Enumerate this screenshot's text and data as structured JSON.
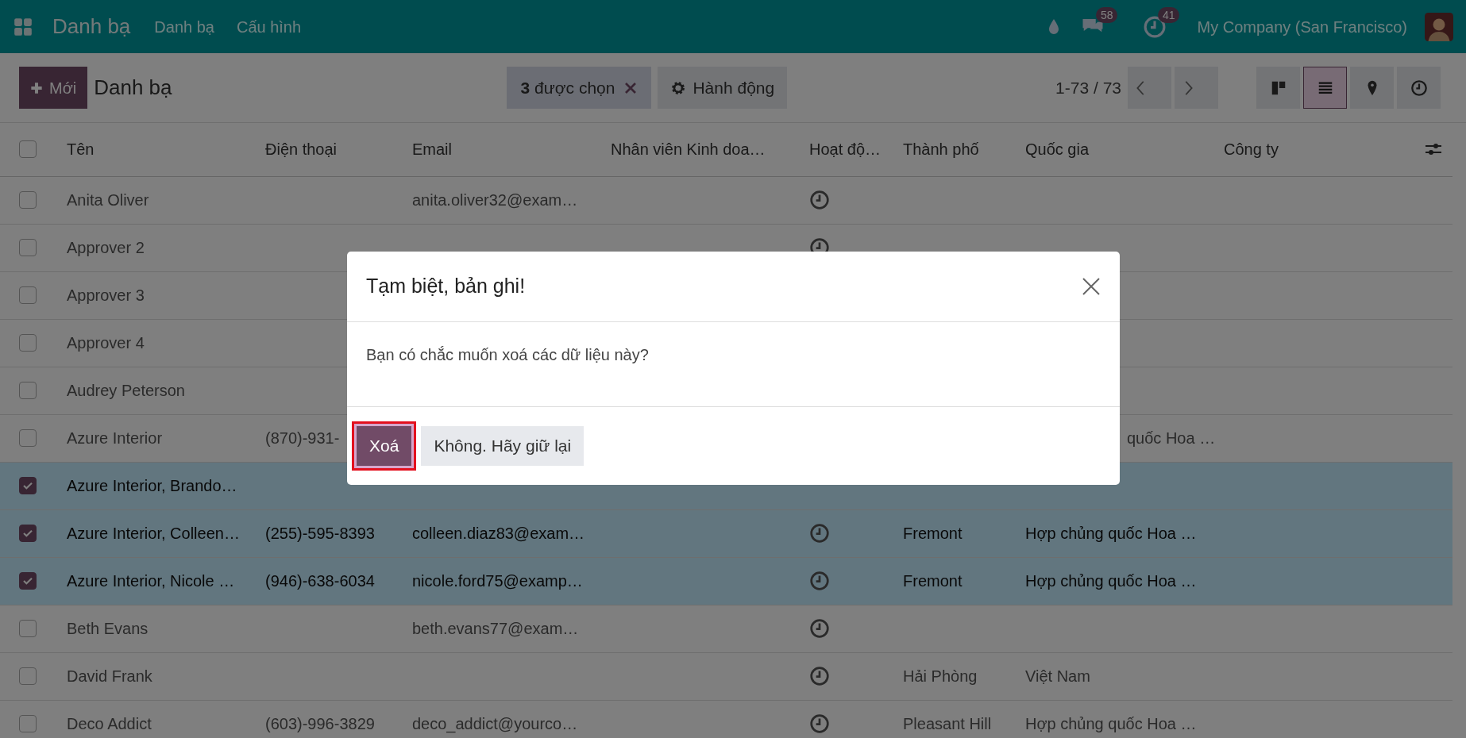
{
  "navbar": {
    "app_title": "Danh bạ",
    "menus": [
      "Danh bạ",
      "Cấu hình"
    ],
    "messages_badge": "58",
    "activities_badge": "41",
    "company": "My Company (San Francisco)"
  },
  "control_panel": {
    "new_button": "Mới",
    "breadcrumb": "Danh bạ",
    "selection": "**3** được chọn",
    "action_button": "Hành động",
    "pager": "1-73 / 73",
    "views": [
      {
        "kind": "kanban",
        "selected": false
      },
      {
        "kind": "list",
        "selected": true
      },
      {
        "kind": "map",
        "selected": false
      },
      {
        "kind": "activity",
        "selected": false
      }
    ]
  },
  "table": {
    "all_selected": false,
    "columns": [
      "Tên",
      "Điện thoại",
      "Email",
      "Nhân viên Kinh doa…",
      "Hoạt độ…",
      "Thành phố",
      "Quốc gia",
      "Công ty"
    ],
    "rows": [
      {
        "name": "Anita Oliver",
        "email": "anita.oliver32@exam…",
        "activity": true,
        "selected": false
      },
      {
        "name": "Approver 2",
        "activity": true,
        "selected": false
      },
      {
        "name": "Approver 3",
        "activity": false,
        "selected": false
      },
      {
        "name": "Approver 4",
        "activity": false,
        "selected": false
      },
      {
        "name": "Audrey Peterson",
        "activity": false,
        "selected": false
      },
      {
        "name": "Azure Interior",
        "phone": "(870)-931-",
        "activity": false,
        "country": "quốc Hoa …",
        "country_clipped": true,
        "selected": false
      },
      {
        "name": "Azure Interior, Brando…",
        "activity": false,
        "selected": true
      },
      {
        "name": "Azure Interior, Colleen…",
        "phone": "(255)-595-8393",
        "email": "colleen.diaz83@exam…",
        "activity": true,
        "city": "Fremont",
        "country": "Hợp chủng quốc Hoa …",
        "selected": true
      },
      {
        "name": "Azure Interior, Nicole …",
        "phone": "(946)-638-6034",
        "email": "nicole.ford75@examp…",
        "activity": true,
        "city": "Fremont",
        "country": "Hợp chủng quốc Hoa …",
        "selected": true
      },
      {
        "name": "Beth Evans",
        "email": "beth.evans77@exam…",
        "activity": true,
        "selected": false
      },
      {
        "name": "David Frank",
        "activity": true,
        "city": "Hải Phòng",
        "country": "Việt Nam",
        "selected": false
      },
      {
        "name": "Deco Addict",
        "phone": "(603)-996-3829",
        "email": "deco_addict@yourco…",
        "activity": true,
        "city": "Pleasant Hill",
        "country": "Hợp chủng quốc Hoa …",
        "selected": false
      }
    ]
  },
  "dialog": {
    "title": "Tạm biệt, bản ghi!",
    "message": "Bạn có chắc muốn xoá các dữ liệu này?",
    "buttons": [
      {
        "label": "Xoá",
        "kind": "primary",
        "highlighted": true
      },
      {
        "label": "Không. Hãy giữ lại",
        "kind": "secondary",
        "highlighted": false
      }
    ]
  }
}
